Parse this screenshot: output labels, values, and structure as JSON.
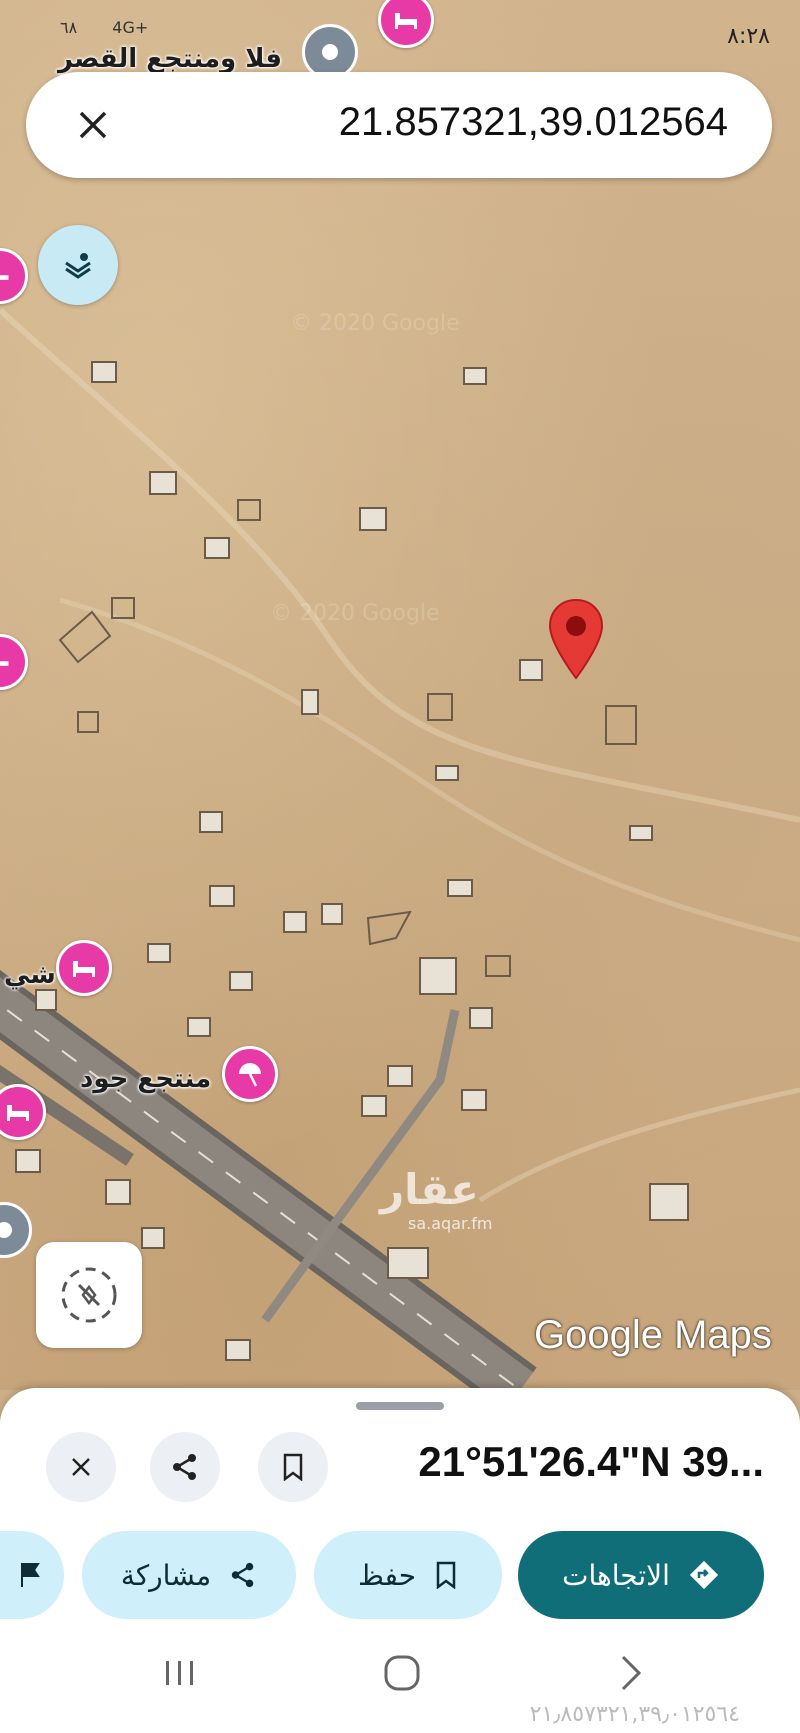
{
  "status": {
    "time": "٨:٢٨",
    "network": "4G+",
    "battery": "٦٨"
  },
  "search": {
    "query": "21.857321,39.012564",
    "close_icon": "close-icon"
  },
  "map": {
    "pois": [
      {
        "label": "فلا ومنتجع القصر",
        "icon": "location-icon"
      },
      {
        "label": "منتجع جود",
        "icon": "umbrella-icon"
      },
      {
        "label": "شي",
        "icon": "hotel-icon"
      }
    ],
    "watermark": "عقار",
    "watermark_sub": "sa.aqar.fm",
    "brand": "Google Maps",
    "pin_color": "#e53935"
  },
  "sheet": {
    "title": "21°51'26.4\"N 39...",
    "actions": {
      "directions": "الاتجاهات",
      "save": "حفظ",
      "share": "مشاركة"
    }
  },
  "bottom_echo": "٢١٫٨٥٧٣٢١,٣٩٫٠١٢٥٦٤"
}
